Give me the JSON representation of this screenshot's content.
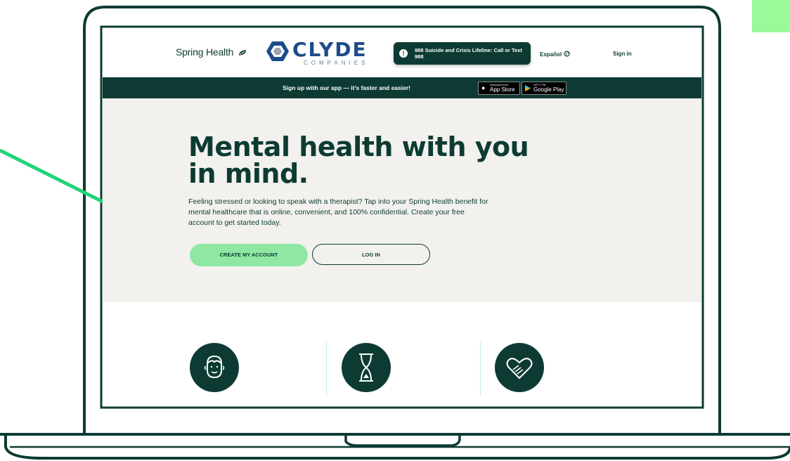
{
  "header": {
    "brand": "Spring Health",
    "partner_logo": {
      "name": "CLYDE",
      "sub": "COMPANIES"
    },
    "crisis_line": {
      "icon": "info-icon",
      "text": "988 Suicide and Crisis Lifeline: Call or Text 988"
    },
    "language_link": "Español",
    "signin_link": "Sign in"
  },
  "promo": {
    "text": "Sign up with our app — it’s faster and easier!",
    "app_store": {
      "small": "Download on the",
      "big": "App Store"
    },
    "google_play": {
      "small": "GET IT ON",
      "big": "Google Play"
    }
  },
  "hero": {
    "title": "Mental health with you in mind.",
    "description": "Feeling stressed or looking to speak with a therapist? Tap into your Spring Health benefit for mental healthcare that is online, convenient, and 100% confidential. Create your free account to get started today.",
    "primary_button": "CREATE MY ACCOUNT",
    "secondary_button": "LOG IN"
  },
  "features": {
    "icons": [
      "person-face-icon",
      "hourglass-icon",
      "heart-hands-icon"
    ]
  },
  "colors": {
    "brand_dark": "#0d3b33",
    "accent_green": "#8ee8a3",
    "hero_bg": "#f2f1ed",
    "arrow_green": "#1ed47a",
    "corner_square": "#98fa98"
  }
}
